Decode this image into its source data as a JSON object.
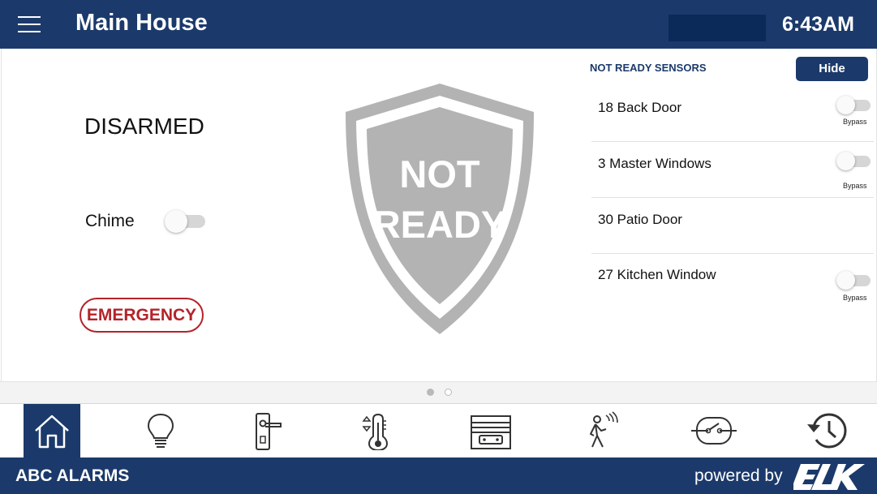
{
  "header": {
    "title": "Main House",
    "time": "6:43AM",
    "menu_icon": "hamburger-menu-icon"
  },
  "status": {
    "arm_state": "DISARMED",
    "chime_label": "Chime",
    "chime_on": false,
    "emergency_label": "EMERGENCY",
    "shield_line1": "NOT",
    "shield_line2": "READY"
  },
  "sensors": {
    "title": "NOT READY SENSORS",
    "hide_label": "Hide",
    "bypass_label": "Bypass",
    "items": [
      {
        "name": "18 Back Door",
        "bypassable": true,
        "bypassed": false
      },
      {
        "name": "3 Master Windows",
        "bypassable": true,
        "bypassed": false
      },
      {
        "name": "30 Patio Door",
        "bypassable": false,
        "bypassed": false
      },
      {
        "name": "27 Kitchen Window",
        "bypassable": true,
        "bypassed": false
      }
    ]
  },
  "pager": {
    "pages": 2,
    "current": 1
  },
  "nav": {
    "items": [
      {
        "icon": "home-icon",
        "active": true
      },
      {
        "icon": "lightbulb-icon",
        "active": false
      },
      {
        "icon": "door-lock-icon",
        "active": false
      },
      {
        "icon": "thermostat-icon",
        "active": false
      },
      {
        "icon": "garage-icon",
        "active": false
      },
      {
        "icon": "motion-sensor-icon",
        "active": false
      },
      {
        "icon": "switch-icon",
        "active": false
      },
      {
        "icon": "history-icon",
        "active": false
      }
    ]
  },
  "footer": {
    "brand": "ABC ALARMS",
    "powered_by": "powered by",
    "logo_text": "ELK"
  },
  "colors": {
    "primary": "#1b3a6b",
    "emergency": "#b4232a",
    "shield": "#b3b3b3"
  }
}
